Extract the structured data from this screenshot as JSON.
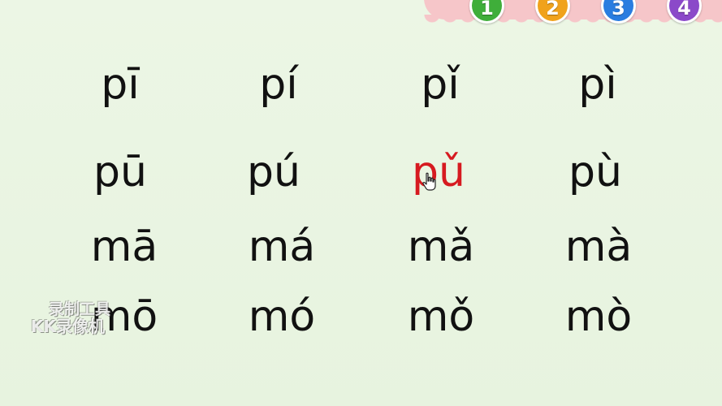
{
  "tabs": [
    {
      "label": "1",
      "color": "#3fae3a"
    },
    {
      "label": "2",
      "color": "#f0a21c"
    },
    {
      "label": "3",
      "color": "#2a7de0"
    },
    {
      "label": "4",
      "color": "#8b49c9"
    }
  ],
  "grid": {
    "rows": [
      [
        "pī",
        "pí",
        "pǐ",
        "pì"
      ],
      [
        "pū",
        "pú",
        "pǔ",
        "pù"
      ],
      [
        "mā",
        "má",
        "mǎ",
        "mà"
      ],
      [
        "mō",
        "mó",
        "mǒ",
        "mò"
      ]
    ],
    "active_color": "#d61a20",
    "text_color": "#111111"
  },
  "cursor": {
    "icon": "hand-pointer-icon"
  },
  "watermark": {
    "line1": "录制工具",
    "line2": "KK录像机"
  }
}
